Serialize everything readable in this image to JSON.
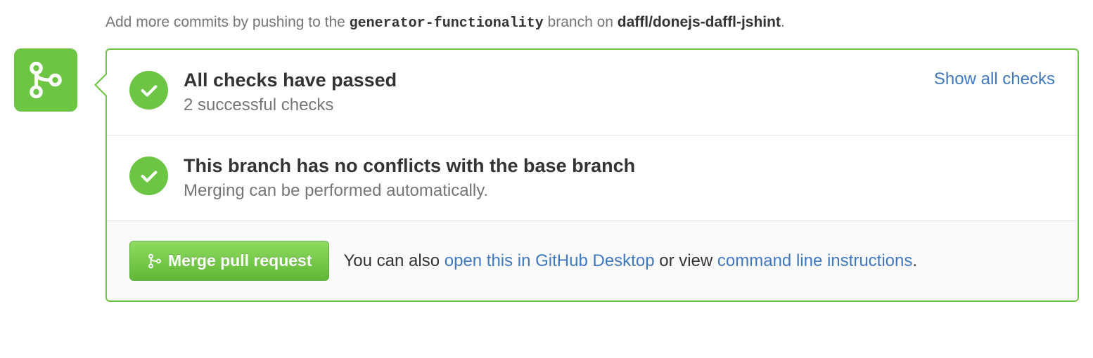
{
  "hint": {
    "prefix": "Add more commits by pushing to the ",
    "branch": "generator-functionality",
    "middle": " branch on ",
    "repo": "daffl/donejs-daffl-jshint",
    "suffix": "."
  },
  "checks": {
    "heading": "All checks have passed",
    "description": "2 successful checks",
    "show_all_label": "Show all checks"
  },
  "conflicts": {
    "heading": "This branch has no conflicts with the base branch",
    "description": "Merging can be performed automatically."
  },
  "merge": {
    "button_label": "Merge pull request",
    "hint_prefix": "You can also ",
    "desktop_link": "open this in GitHub Desktop",
    "hint_middle": " or view ",
    "cli_link": "command line instructions",
    "hint_suffix": "."
  }
}
